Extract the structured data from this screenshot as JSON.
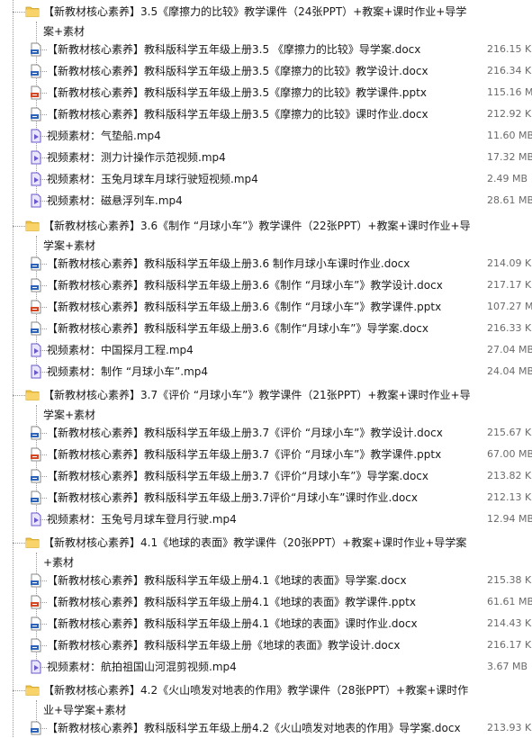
{
  "folders": [
    {
      "name": "【新教材核心素养】3.5《摩擦力的比较》教学课件（24张PPT）+教案+课时作业+导学案+素材",
      "files": [
        {
          "type": "doc",
          "name": "【新教材核心素养】教科版科学五年级上册3.5 《摩擦力的比较》导学案.docx",
          "size": "216.15 KB"
        },
        {
          "type": "doc",
          "name": "【新教材核心素养】教科版科学五年级上册3.5《摩擦力的比较》教学设计.docx",
          "size": "216.34 KB"
        },
        {
          "type": "ppt",
          "name": "【新教材核心素养】教科版科学五年级上册3.5《摩擦力的比较》教学课件.pptx",
          "size": "115.16 MB"
        },
        {
          "type": "doc",
          "name": "【新教材核心素养】教科版科学五年级上册3.5《摩擦力的比较》课时作业.docx",
          "size": "212.92 KB"
        },
        {
          "type": "video",
          "name": "视频素材：气垫船.mp4",
          "size": "11.60 MB"
        },
        {
          "type": "video",
          "name": "视频素材：测力计操作示范视频.mp4",
          "size": "17.32 MB"
        },
        {
          "type": "video",
          "name": "视频素材：玉兔月球车月球行驶短视频.mp4",
          "size": "2.49 MB"
        },
        {
          "type": "video",
          "name": "视频素材：磁悬浮列车.mp4",
          "size": "28.61 MB"
        }
      ]
    },
    {
      "name": "【新教材核心素养】3.6《制作 “月球小车”》教学课件（22张PPT）+教案+课时作业+导学案+素材",
      "files": [
        {
          "type": "doc",
          "name": "【新教材核心素养】教科版科学五年级上册3.6 制作月球小车课时作业.docx",
          "size": "214.09 KB"
        },
        {
          "type": "doc",
          "name": "【新教材核心素养】教科版科学五年级上册3.6《制作 “月球小车”》教学设计.docx",
          "size": "217.17 KB"
        },
        {
          "type": "ppt",
          "name": "【新教材核心素养】教科版科学五年级上册3.6《制作 “月球小车”》教学课件.pptx",
          "size": "107.27 MB"
        },
        {
          "type": "doc",
          "name": "【新教材核心素养】教科版科学五年级上册3.6《制作“月球小车”》导学案.docx",
          "size": "216.33 KB"
        },
        {
          "type": "video",
          "name": "视频素材：中国探月工程.mp4",
          "size": "27.04 MB"
        },
        {
          "type": "video",
          "name": "视频素材：制作 “月球小车”.mp4",
          "size": "24.04 MB"
        }
      ]
    },
    {
      "name": "【新教材核心素养】3.7《评价 “月球小车”》教学课件（21张PPT）+教案+课时作业+导学案+素材",
      "files": [
        {
          "type": "doc",
          "name": "【新教材核心素养】教科版科学五年级上册3.7《评价 “月球小车”》教学设计.docx",
          "size": "215.67 KB"
        },
        {
          "type": "ppt",
          "name": "【新教材核心素养】教科版科学五年级上册3.7《评价 “月球小车”》教学课件.pptx",
          "size": "67.00 MB"
        },
        {
          "type": "doc",
          "name": "【新教材核心素养】教科版科学五年级上册3.7《评价“月球小车”》导学案.docx",
          "size": "213.82 KB"
        },
        {
          "type": "doc",
          "name": "【新教材核心素养】教科版科学五年级上册3.7评价“月球小车”课时作业.docx",
          "size": "212.13 KB"
        },
        {
          "type": "video",
          "name": "视频素材：玉兔号月球车登月行驶.mp4",
          "size": "12.94 MB"
        }
      ]
    },
    {
      "name": "【新教材核心素养】4.1《地球的表面》教学课件（20张PPT）+教案+课时作业+导学案+素材",
      "files": [
        {
          "type": "doc",
          "name": "【新教材核心素养】教科版科学五年级上册4.1《地球的表面》导学案.docx",
          "size": "215.38 KB"
        },
        {
          "type": "ppt",
          "name": "【新教材核心素养】教科版科学五年级上册4.1《地球的表面》教学课件.pptx",
          "size": "61.61 MB"
        },
        {
          "type": "doc",
          "name": "【新教材核心素养】教科版科学五年级上册4.1《地球的表面》课时作业.docx",
          "size": "214.43 KB"
        },
        {
          "type": "doc",
          "name": "【新教材核心素养】教科版科学五年级上册《地球的表面》教学设计.docx",
          "size": "216.17 KB"
        },
        {
          "type": "video",
          "name": "视频素材：航拍祖国山河混剪视频.mp4",
          "size": "3.67 MB"
        }
      ]
    },
    {
      "name": "【新教材核心素养】4.2《火山喷发对地表的作用》教学课件（28张PPT）+教案+课时作业+导学案+素材",
      "files": [
        {
          "type": "doc",
          "name": "【新教材核心素养】教科版科学五年级上册4.2《火山喷发对地表的作用》导学案.docx",
          "size": "213.93 KB"
        }
      ]
    }
  ],
  "colors": {
    "folder": "#f2c242",
    "doc": "#2f63b8",
    "ppt": "#d24726",
    "video": "#6a5acd",
    "tree_line": "#9a9a9a",
    "size_text": "#6a6a6a"
  }
}
